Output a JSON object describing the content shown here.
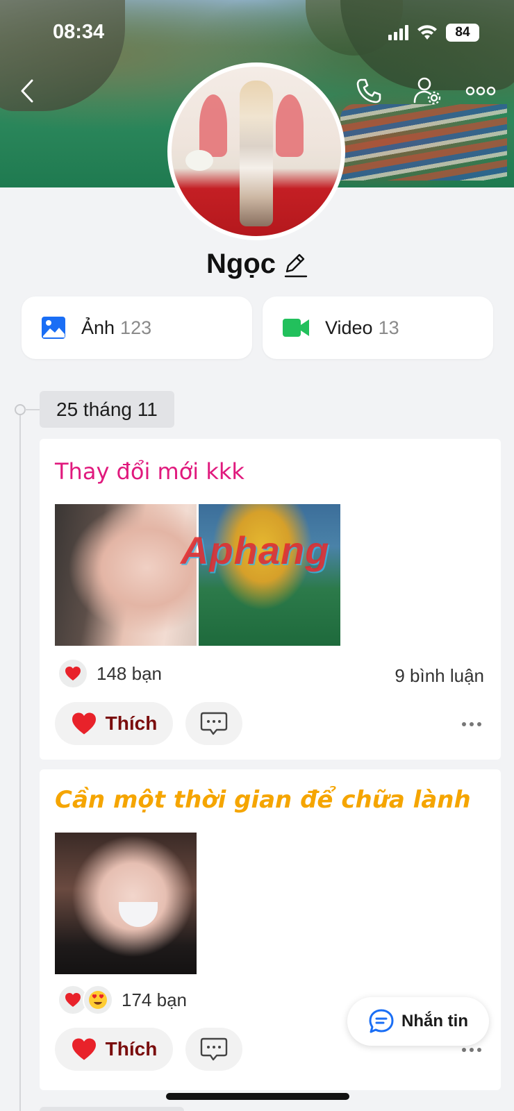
{
  "status_bar": {
    "time": "08:34",
    "battery": "84"
  },
  "profile": {
    "name": "Ngọc"
  },
  "media": [
    {
      "label": "Ảnh",
      "count": "123",
      "icon": "photo-icon",
      "color": "#1a6ef5"
    },
    {
      "label": "Video",
      "count": "13",
      "icon": "video-camera-icon",
      "color": "#22c05c"
    }
  ],
  "timeline": {
    "date": "25 tháng 11"
  },
  "posts": [
    {
      "title": "Thay đổi mới kkk",
      "title_color": "#e0197d",
      "watermark": "Aphang",
      "reactions": [
        "heart"
      ],
      "reaction_count": "148 bạn",
      "comment_count": "9 bình luận",
      "like_label": "Thích"
    },
    {
      "title": "Cần một thời gian để chữa lành",
      "title_color": "#f5a500",
      "reactions": [
        "heart",
        "heart-eyes"
      ],
      "reaction_count": "174 bạn",
      "like_label": "Thích"
    }
  ],
  "fab": {
    "label": "Nhắn tin"
  }
}
